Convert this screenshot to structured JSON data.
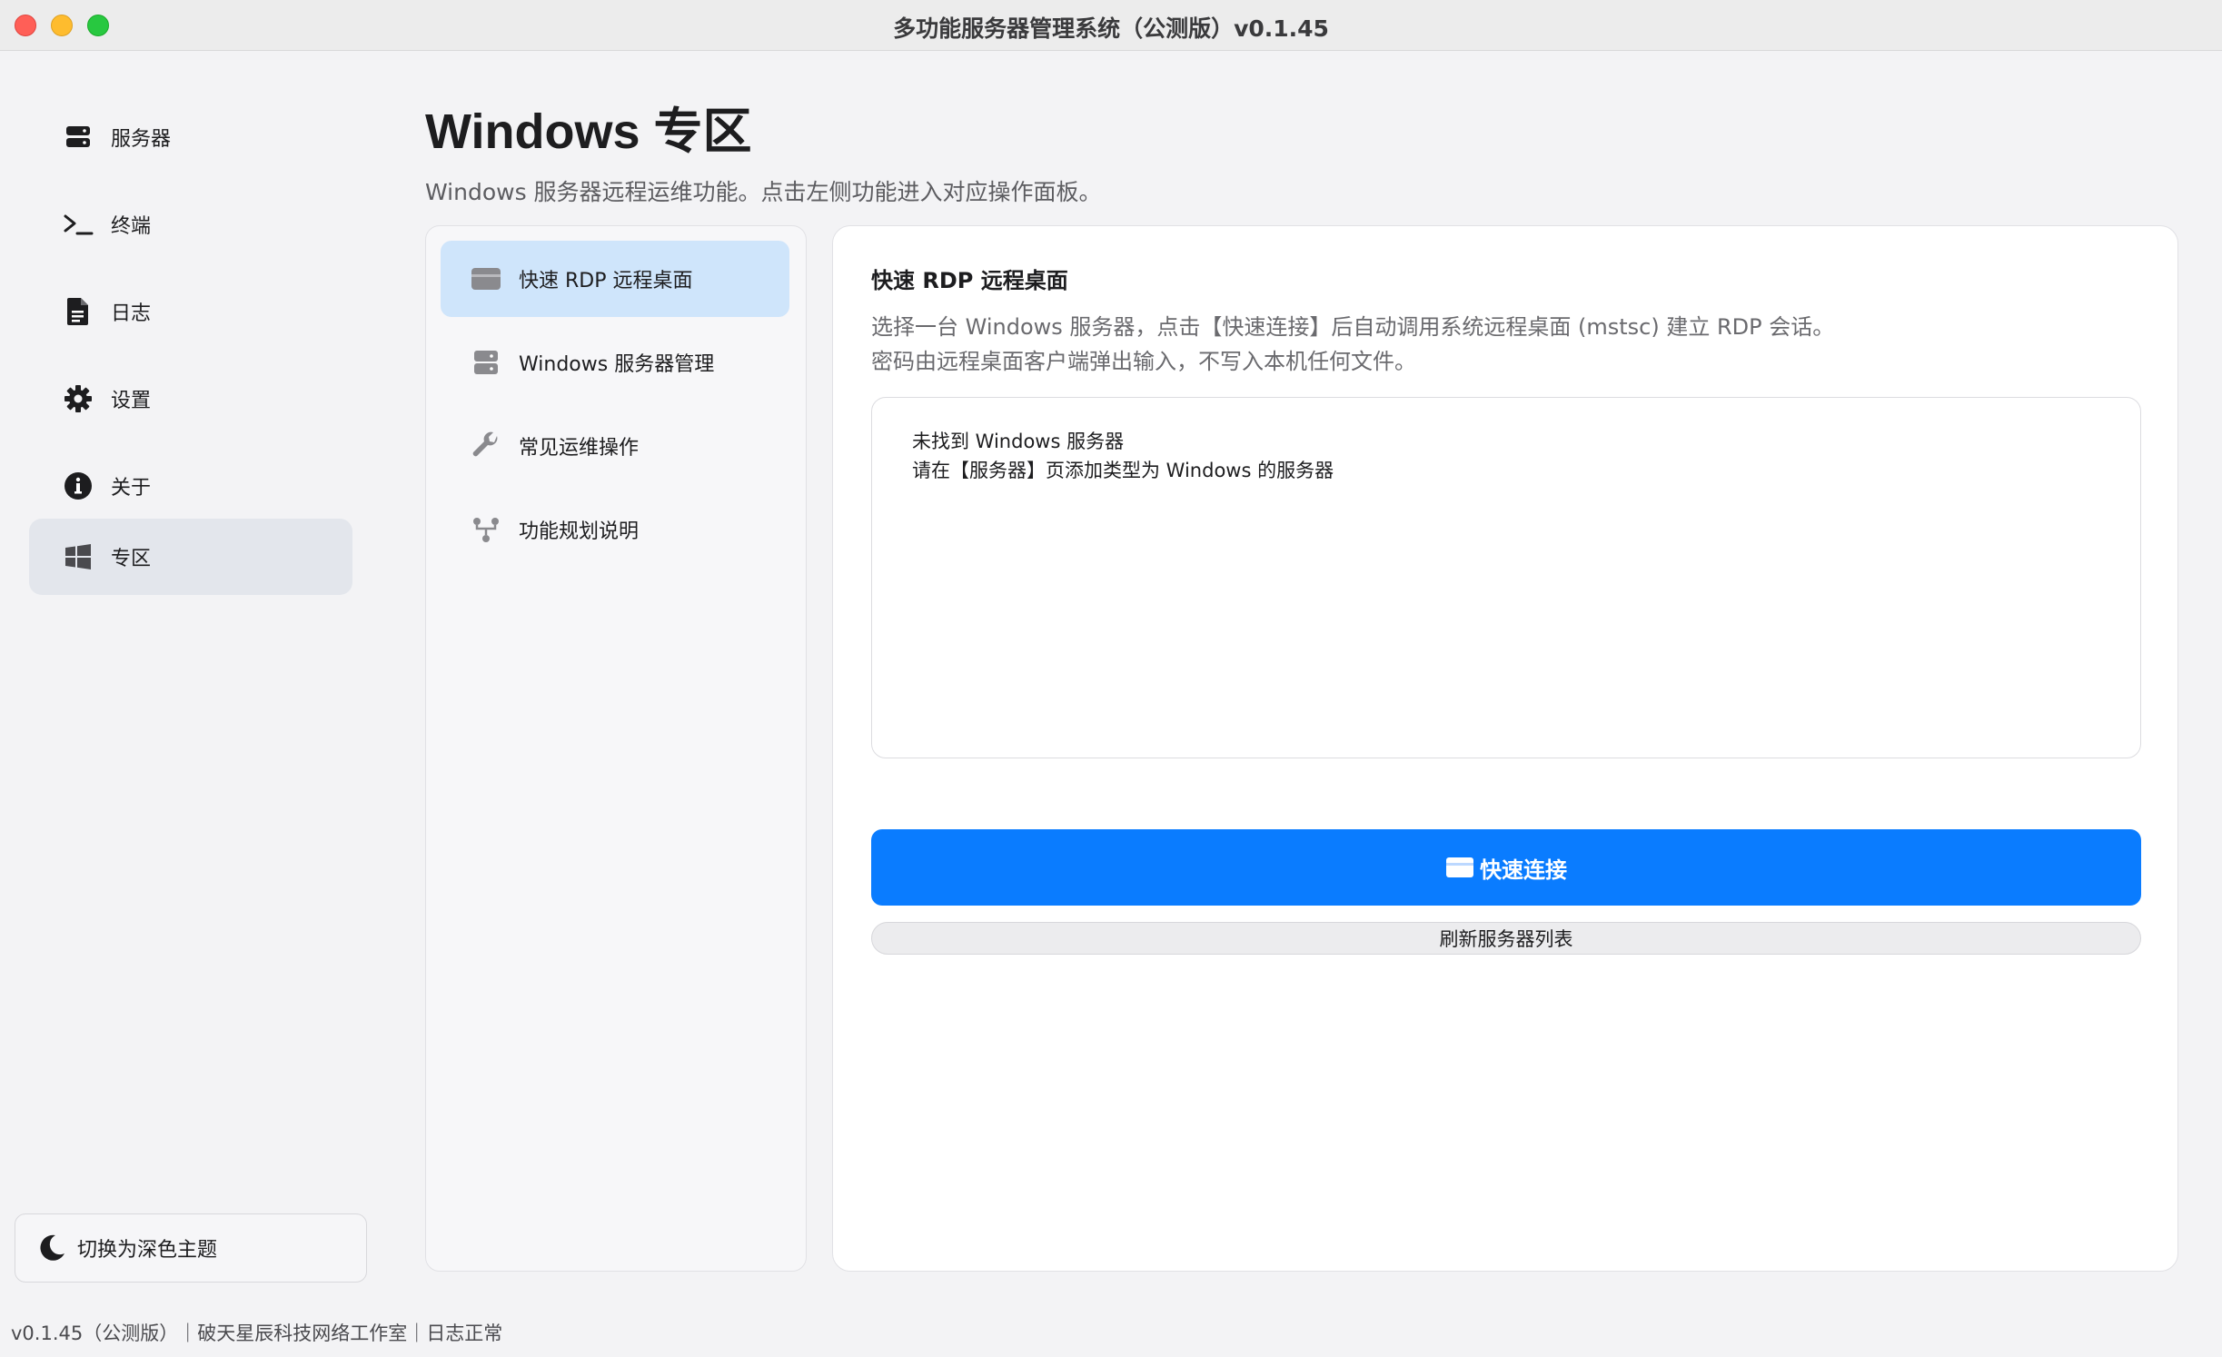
{
  "window": {
    "title": "多功能服务器管理系统（公测版）v0.1.45"
  },
  "sidebar": {
    "items": [
      {
        "label": "服务器",
        "icon": "server-icon"
      },
      {
        "label": "终端",
        "icon": "terminal-icon"
      },
      {
        "label": "日志",
        "icon": "document-icon"
      },
      {
        "label": "设置",
        "icon": "gear-icon"
      },
      {
        "label": "关于",
        "icon": "info-icon"
      },
      {
        "label": "专区",
        "icon": "windows-icon",
        "active": true
      }
    ],
    "theme_toggle": {
      "label": "切换为深色主题",
      "icon": "moon-icon"
    }
  },
  "status_bar": {
    "text": "v0.1.45（公测版）｜破天星辰科技网络工作室｜日志正常"
  },
  "main": {
    "title": "Windows 专区",
    "subtitle": "Windows 服务器远程运维功能。点击左侧功能进入对应操作面板。",
    "subnav": [
      {
        "label": "快速 RDP 远程桌面",
        "icon": "remote-desktop-icon",
        "active": true
      },
      {
        "label": "Windows 服务器管理",
        "icon": "server-icon"
      },
      {
        "label": "常见运维操作",
        "icon": "wrench-icon"
      },
      {
        "label": "功能规划说明",
        "icon": "sitemap-icon"
      }
    ],
    "panel": {
      "title": "快速 RDP 远程桌面",
      "description_line1": "选择一台 Windows 服务器，点击【快速连接】后自动调用系统远程桌面 (mstsc) 建立 RDP 会话。",
      "description_line2": "密码由远程桌面客户端弹出输入，不写入本机任何文件。",
      "result_line1": "未找到 Windows 服务器",
      "result_line2": "请在【服务器】页添加类型为 Windows 的服务器",
      "connect_label": "快速连接",
      "refresh_label": "刷新服务器列表"
    }
  },
  "colors": {
    "accent": "#0a7cff",
    "active_subnav": "#cfe5fb",
    "active_nav": "#e3e6ec"
  }
}
